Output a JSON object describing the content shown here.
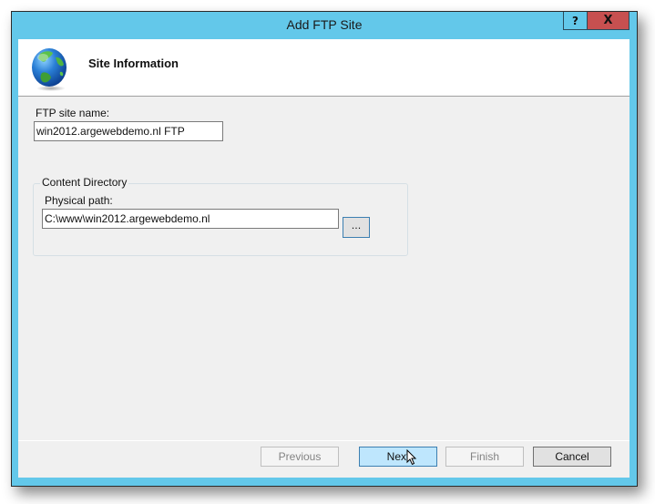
{
  "window": {
    "title": "Add FTP Site",
    "help_label": "?",
    "close_label": "X"
  },
  "header": {
    "icon": "globe-icon",
    "title": "Site Information"
  },
  "form": {
    "site_name_label": "FTP site name:",
    "site_name_value": "win2012.argewebdemo.nl FTP",
    "content_directory": {
      "legend": "Content Directory",
      "physical_path_label": "Physical path:",
      "physical_path_value": "C:\\www\\win2012.argewebdemo.nl",
      "browse_label": "..."
    }
  },
  "buttons": {
    "previous": "Previous",
    "next": "Next",
    "finish": "Finish",
    "cancel": "Cancel"
  },
  "colors": {
    "frame": "#63c8ea",
    "close": "#c75050",
    "hover_button": "#bee6fd"
  }
}
